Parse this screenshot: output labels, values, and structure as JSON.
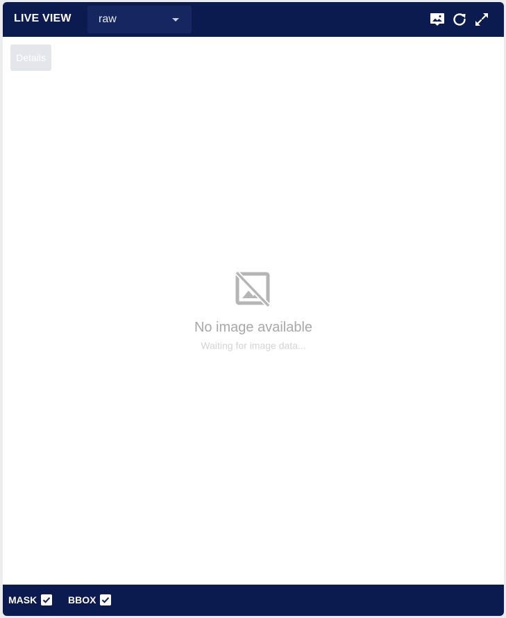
{
  "header": {
    "title": "LIVE VIEW",
    "view_select": {
      "value": "raw"
    },
    "actions": [
      {
        "icon": "image-comment-icon"
      },
      {
        "icon": "refresh-icon"
      },
      {
        "icon": "fullscreen-icon"
      }
    ]
  },
  "toolbar": {
    "details_label": "Details"
  },
  "empty_state": {
    "icon": "image-not-supported-icon",
    "title": "No image available",
    "subtitle": "Waiting for image data..."
  },
  "footer": {
    "toggles": [
      {
        "label": "MASK",
        "checked": true
      },
      {
        "label": "BBOX",
        "checked": true
      }
    ]
  },
  "colors": {
    "header_bg": "#0b1a4f",
    "select_bg": "#15275e",
    "panel_bg": "#ffffff",
    "page_bg": "#ececef",
    "details_bg": "#e4e6ec",
    "empty_title": "#a8a8a8",
    "empty_subtitle": "#d3d3d3"
  }
}
